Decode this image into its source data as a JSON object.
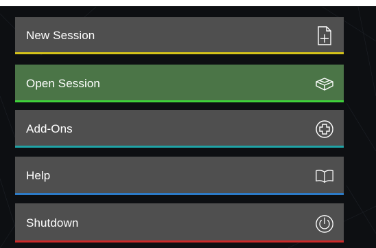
{
  "menu": {
    "items": [
      {
        "id": "new-session",
        "label": "New Session",
        "icon": "new-document-icon",
        "accent": "#d4c21a",
        "active": false
      },
      {
        "id": "open-session",
        "label": "Open Session",
        "icon": "open-box-icon",
        "accent": "#3fd13a",
        "active": true
      },
      {
        "id": "add-ons",
        "label": "Add-Ons",
        "icon": "plus-circle-icon",
        "accent": "#1fa3a6",
        "active": false
      },
      {
        "id": "help",
        "label": "Help",
        "icon": "open-book-icon",
        "accent": "#2d7bc7",
        "active": false
      },
      {
        "id": "shutdown",
        "label": "Shutdown",
        "icon": "power-icon",
        "accent": "#cc2a2a",
        "active": false
      }
    ]
  },
  "colors": {
    "item_bg": "#4f4f4f",
    "active_bg": "#4b7547",
    "page_bg": "#0d0f12"
  }
}
